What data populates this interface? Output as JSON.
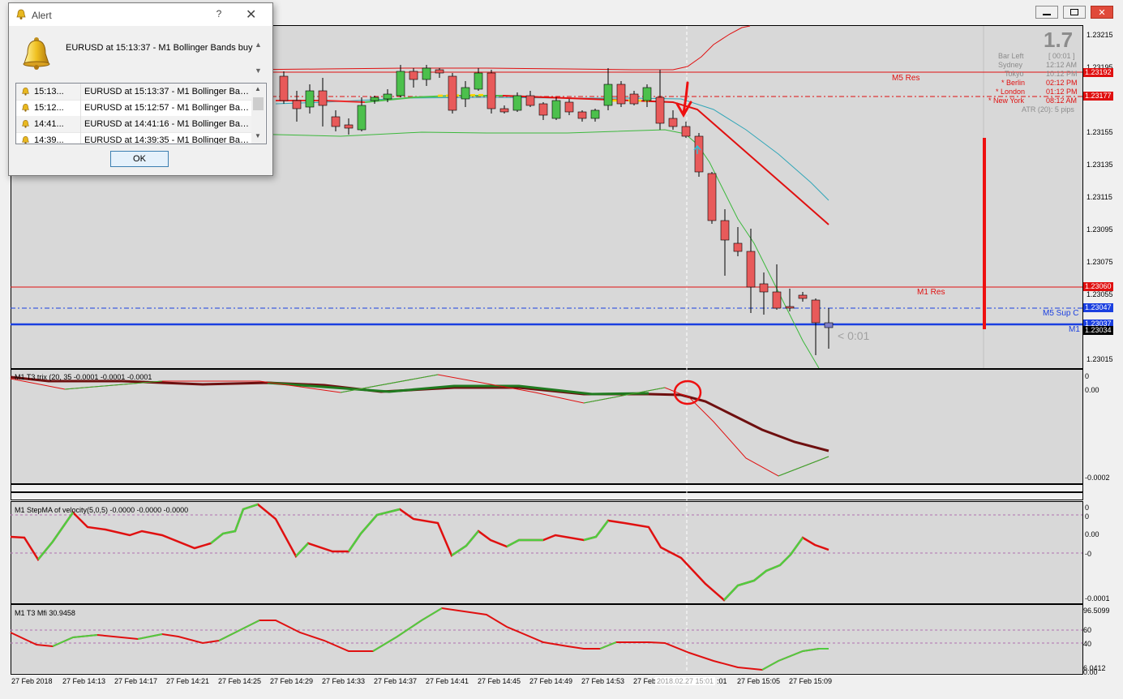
{
  "window": {
    "controls": [
      "minimize",
      "restore",
      "close"
    ]
  },
  "chart": {
    "price_axis": [
      "1.23215",
      "1.23195",
      "1.23155",
      "1.23135",
      "1.23115",
      "1.23095",
      "1.23075",
      "1.23055",
      "1.23015"
    ],
    "price_tags": [
      {
        "value": "1.23192",
        "color": "#e01010"
      },
      {
        "value": "1.23177",
        "color": "#e01010"
      },
      {
        "value": "1.23060",
        "color": "#e01010"
      },
      {
        "value": "1.23047",
        "color": "#1a3fe0"
      },
      {
        "value": "1.23037",
        "color": "#1a3fe0"
      },
      {
        "value": "1.23034",
        "color": "#000000"
      }
    ],
    "level_labels": {
      "m5_res": "M5 Res",
      "m1_res": "M1 Res",
      "m5_sup": "M5 Sup C",
      "m1_sup": "M1"
    },
    "countdown": "< 0:01",
    "info": {
      "big_value": "1.7",
      "rows": [
        {
          "label": "Bar Left",
          "value": "[ 00:01 ]"
        },
        {
          "label": "Sydney",
          "value": "12:12 AM"
        },
        {
          "label": "Tokyo",
          "value": "10:12 PM"
        },
        {
          "label": "* Berlin",
          "value": "02:12 PM"
        },
        {
          "label": "* London",
          "value": "01:12 PM"
        },
        {
          "label": "* New York",
          "value": "08:12 AM"
        }
      ],
      "atr": "ATR (20): 5 pips"
    }
  },
  "indicators": {
    "t3": {
      "title": "M1  T3 trix (20, 35 -0.0001 -0.0001 -0.0001",
      "axis": [
        "0",
        "0.00",
        "-0.0002"
      ]
    },
    "stepma": {
      "title": "M1 StepMA of velocity(5,0,5) -0.0000 -0.0000 -0.0000",
      "axis": [
        "0",
        "0",
        "0.00",
        "-0",
        "-0.0001"
      ]
    },
    "mfi": {
      "title": "M1  T3 Mfi  30.9458",
      "axis": [
        "96.5099",
        "60",
        "40",
        "6.0412",
        "0.00"
      ]
    }
  },
  "time_axis": [
    "27 Feb 2018",
    "27 Feb 14:13",
    "27 Feb 14:17",
    "27 Feb 14:21",
    "27 Feb 14:25",
    "27 Feb 14:29",
    "27 Feb 14:33",
    "27 Feb 14:37",
    "27 Feb 14:41",
    "27 Feb 14:45",
    "27 Feb 14:49",
    "27 Feb 14:53",
    "27 Feb",
    "2018.02.27 15:01",
    ":01",
    "27 Feb 15:05",
    "27 Feb 15:09"
  ],
  "alert": {
    "title": "Alert",
    "help": "?",
    "close": "✕",
    "message": "EURUSD at 15:13:37 - M1 Bollinger Bands buy",
    "rows": [
      {
        "time": "15:13...",
        "message": "EURUSD at 15:13:37 - M1 Bollinger Band..."
      },
      {
        "time": "15:12...",
        "message": "EURUSD at 15:12:57 - M1 Bollinger Band..."
      },
      {
        "time": "14:41...",
        "message": "EURUSD at 14:41:16 - M1 Bollinger Band..."
      },
      {
        "time": "14:39...",
        "message": "EURUSD at 14:39:35 - M1 Bollinger Band..."
      }
    ],
    "ok_label": "OK"
  },
  "colors": {
    "bull": "#4cc04c",
    "bear": "#e85a5a",
    "resistance": "#e01010",
    "support": "#1a3fe0"
  }
}
